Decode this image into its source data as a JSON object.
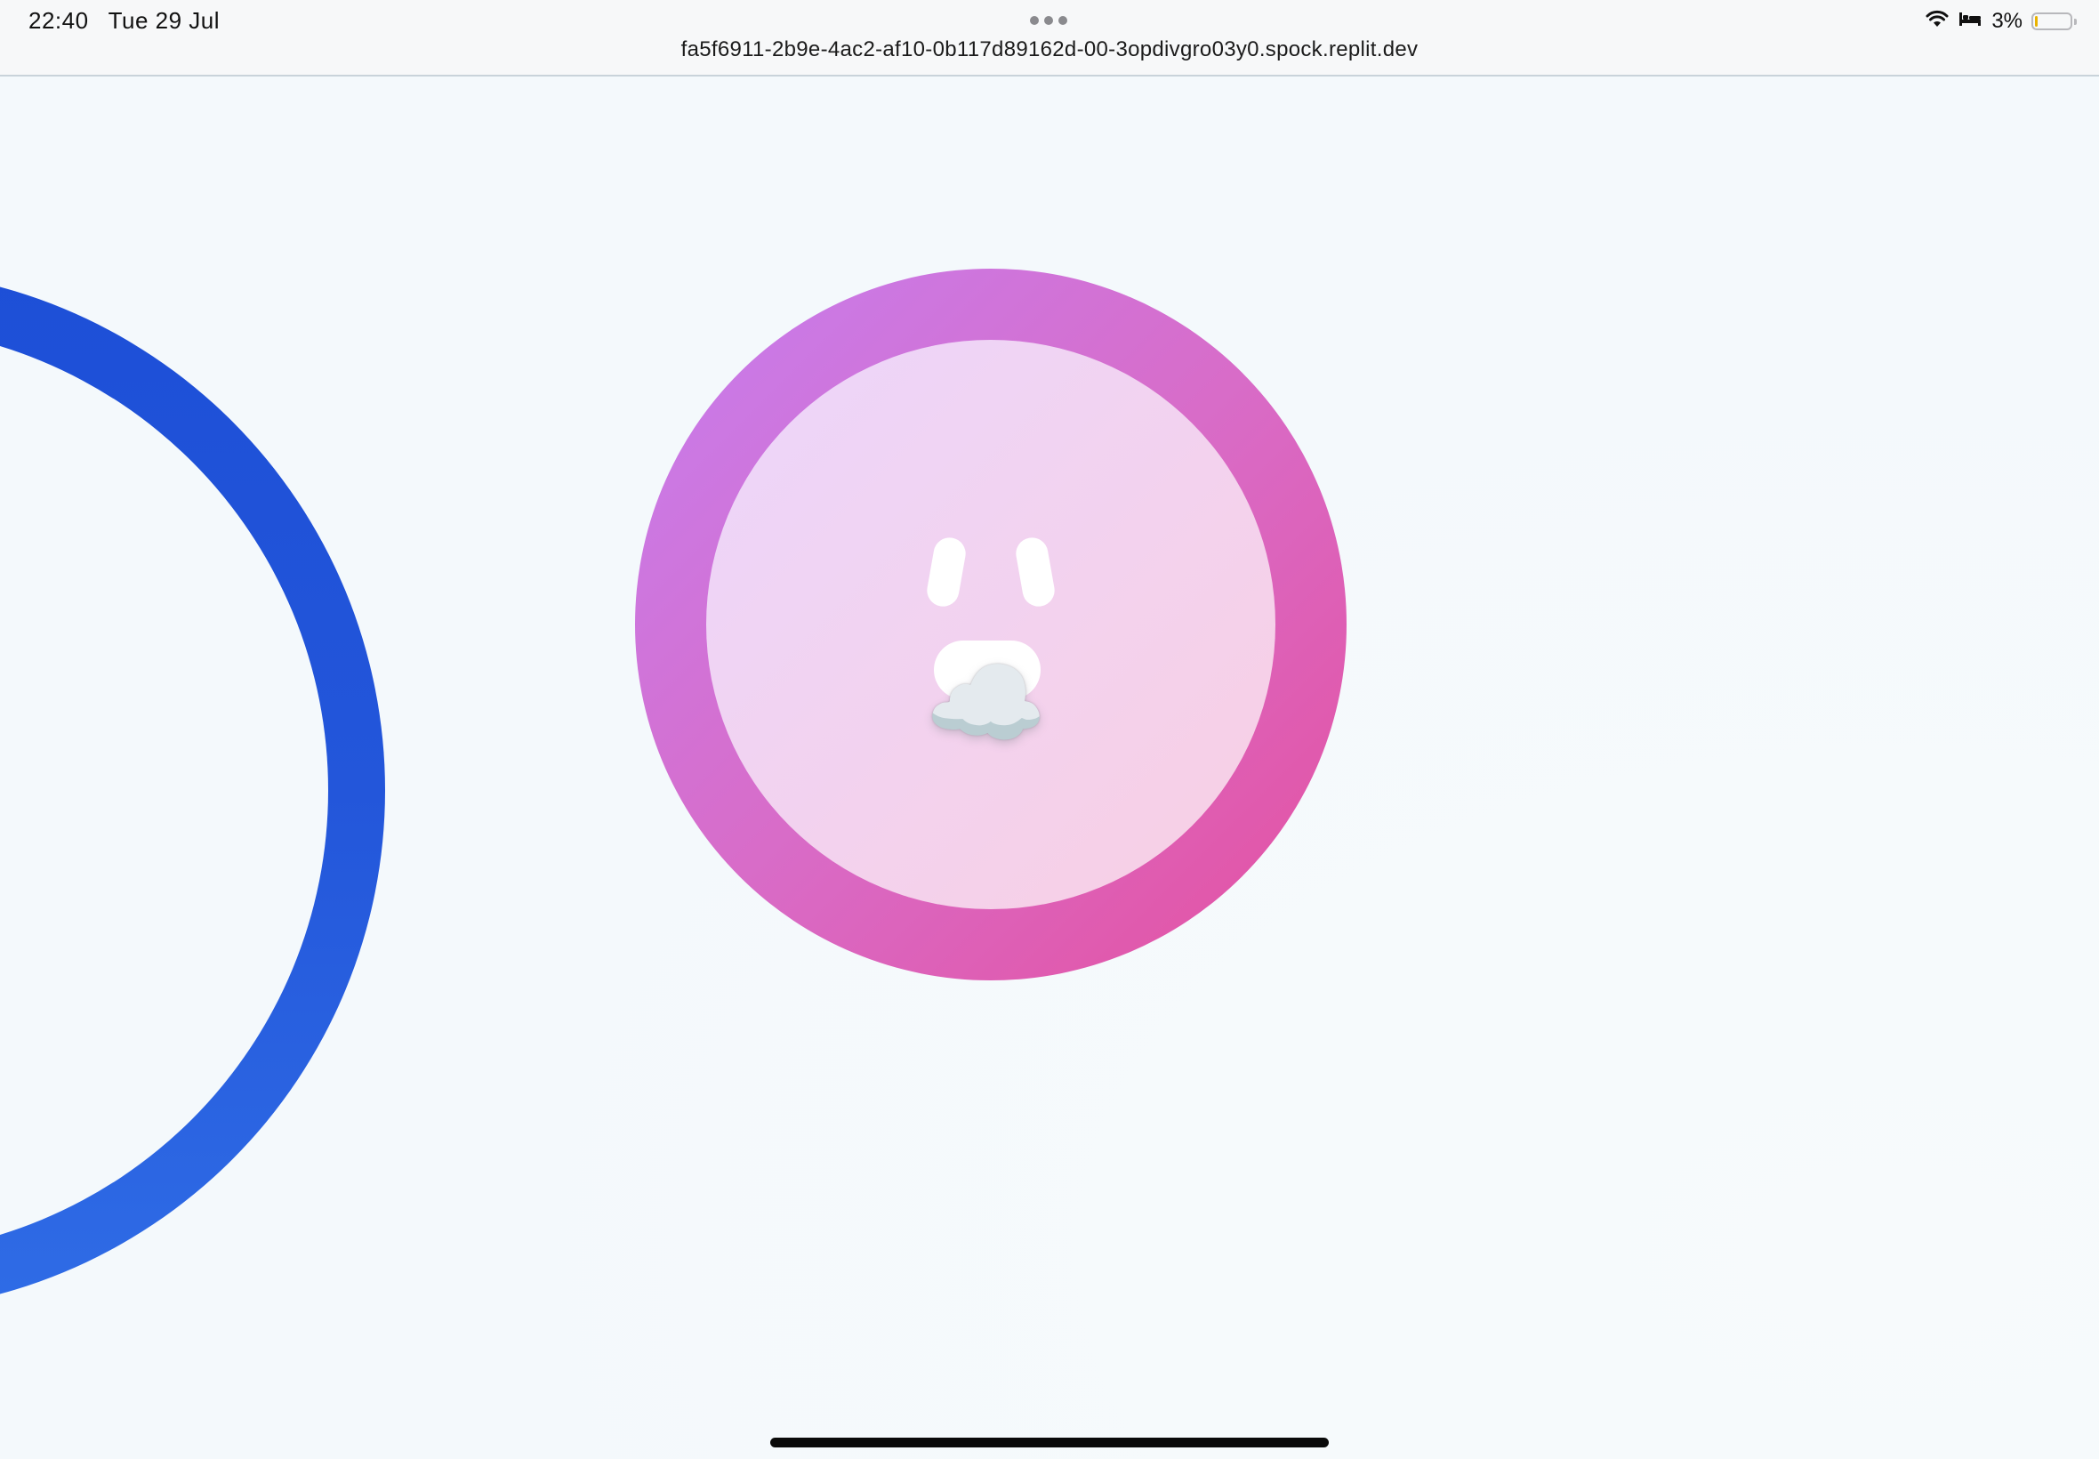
{
  "status_bar": {
    "time": "22:40",
    "date": "Tue 29 Jul",
    "url": "fa5f6911-2b9e-4ac2-af10-0b117d89162d-00-3opdivgro03y0.spock.replit.dev",
    "battery_percent": "3%",
    "battery_level": 0.03,
    "icons": [
      "wifi-icon",
      "sleep-focus-icon",
      "battery-icon",
      "more-dots-icon"
    ]
  },
  "scene": {
    "character_emoji": "☁️",
    "colors": {
      "background": "#f4f9fc",
      "left_ring": "#2356da",
      "orb_outer_start": "#c57ef0",
      "orb_outer_end": "#e5509f",
      "orb_inner": "#f3d2ee"
    }
  }
}
